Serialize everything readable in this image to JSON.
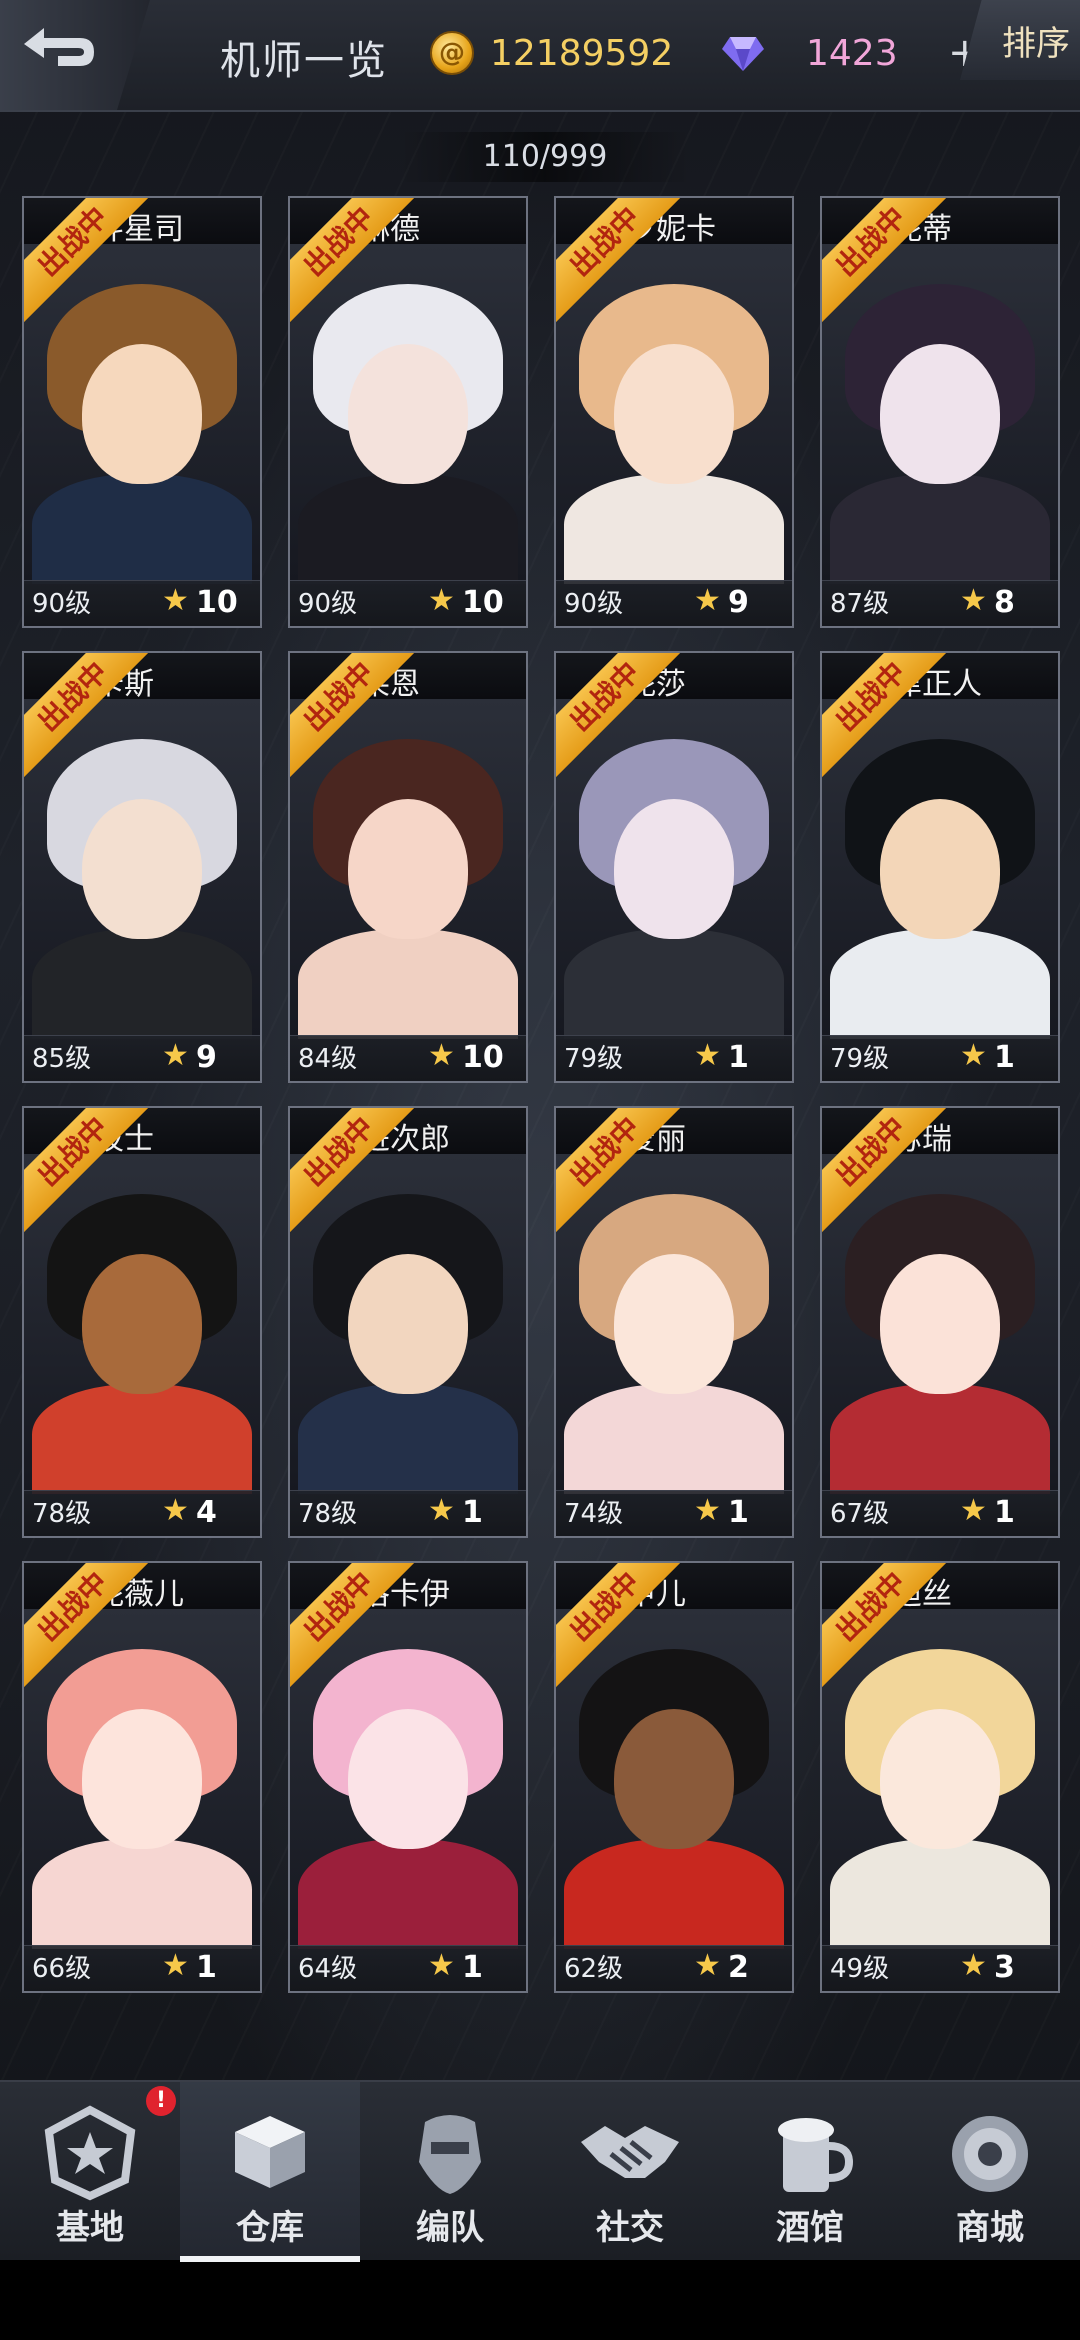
{
  "header": {
    "title": "机师一览",
    "gold": "12189592",
    "gems": "1423",
    "plus": "+",
    "sort_label": "排序"
  },
  "roster_count": "110/999",
  "deployed_label": "出战中",
  "pilots": [
    {
      "name": "斗星司",
      "level": "90级",
      "stars": "10",
      "hair": "#8a5a2b",
      "skin": "#f6d8bd",
      "body": "#1f2d46"
    },
    {
      "name": "琳德",
      "level": "90级",
      "stars": "10",
      "hair": "#e9e9ef",
      "skin": "#f4e2dc",
      "body": "#1b1b22"
    },
    {
      "name": "罗妮卡",
      "level": "90级",
      "stars": "9",
      "hair": "#e8b98c",
      "skin": "#f8dfcd",
      "body": "#efe7e1"
    },
    {
      "name": "妮蒂",
      "level": "87级",
      "stars": "8",
      "hair": "#2d2336",
      "skin": "#efe3ec",
      "body": "#2a2834"
    },
    {
      "name": "卡斯",
      "level": "85级",
      "stars": "9",
      "hair": "#d8d8e0",
      "skin": "#f3dfd0",
      "body": "#222428"
    },
    {
      "name": "莱恩",
      "level": "84级",
      "stars": "10",
      "hair": "#4a2620",
      "skin": "#f6d6c8",
      "body": "#f0d0c2"
    },
    {
      "name": "妮莎",
      "level": "79级",
      "stars": "1",
      "hair": "#9a97b9",
      "skin": "#efe3ec",
      "body": "#2c2f37"
    },
    {
      "name": "津正人",
      "level": "79级",
      "stars": "1",
      "hair": "#101317",
      "skin": "#f3d6b8",
      "body": "#e9ecf0"
    },
    {
      "name": "波士",
      "level": "78级",
      "stars": "4",
      "hair": "#141414",
      "skin": "#a86a3b",
      "body": "#d0402c"
    },
    {
      "name": "进次郎",
      "level": "78级",
      "stars": "1",
      "hair": "#15161a",
      "skin": "#f2d6bf",
      "body": "#243049"
    },
    {
      "name": "爱丽",
      "level": "74级",
      "stars": "1",
      "hair": "#d7a880",
      "skin": "#fbe6da",
      "body": "#f3d7d7"
    },
    {
      "name": "苏瑞",
      "level": "67级",
      "stars": "1",
      "hair": "#2b1f22",
      "skin": "#fbe2d8",
      "body": "#b42c33"
    },
    {
      "name": "妮薇儿",
      "level": "66级",
      "stars": "1",
      "hair": "#f29d94",
      "skin": "#fde4dc",
      "body": "#f6d6d2"
    },
    {
      "name": "洛卡伊",
      "level": "64级",
      "stars": "1",
      "hair": "#f3b4cf",
      "skin": "#fbe3e7",
      "body": "#9b1f3b"
    },
    {
      "name": "甲儿",
      "level": "62级",
      "stars": "2",
      "hair": "#141314",
      "skin": "#8a5a3a",
      "body": "#c8281f"
    },
    {
      "name": "迪丝",
      "level": "49级",
      "stars": "3",
      "hair": "#f2d69a",
      "skin": "#fbe8dc",
      "body": "#ece7de"
    }
  ],
  "nav": [
    {
      "label": "基地",
      "icon": "base-icon",
      "badge": "!"
    },
    {
      "label": "仓库",
      "icon": "warehouse-icon"
    },
    {
      "label": "编队",
      "icon": "formation-icon"
    },
    {
      "label": "社交",
      "icon": "handshake-icon"
    },
    {
      "label": "酒馆",
      "icon": "tavern-icon"
    },
    {
      "label": "商城",
      "icon": "shop-icon"
    }
  ],
  "colors": {
    "gold_text": "#f4cf63",
    "gem_text": "#f1a6d9",
    "ribbon": "#f7c24b",
    "star": "#f6c84a",
    "badge": "#e0232e"
  }
}
